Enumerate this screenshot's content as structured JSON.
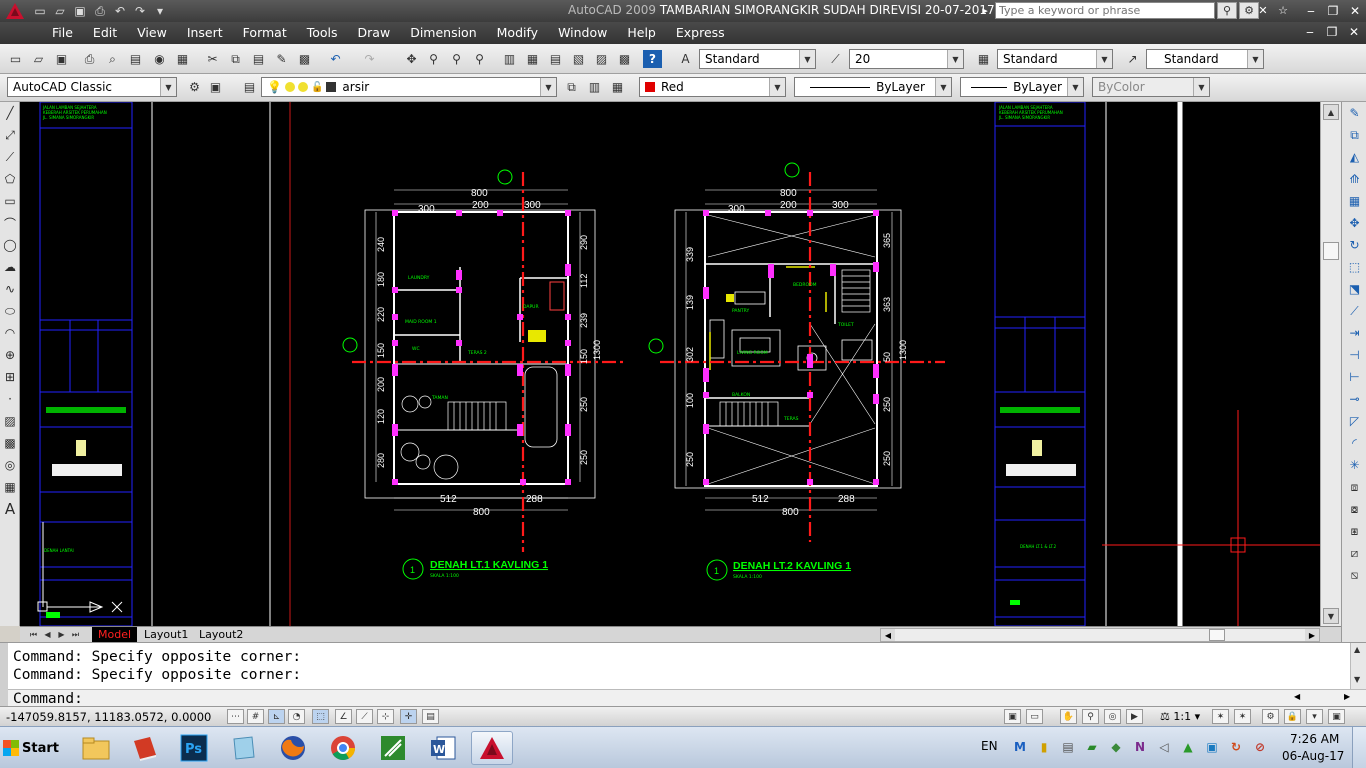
{
  "titlebar": {
    "app_version": "AutoCAD 2009",
    "file_name": "TAMBARIAN SIMORANGKIR SUDAH DIREVISI 20-07-2017.dwg",
    "search_placeholder": "Type a keyword or phrase"
  },
  "menubar": {
    "items": [
      "File",
      "Edit",
      "View",
      "Insert",
      "Format",
      "Tools",
      "Draw",
      "Dimension",
      "Modify",
      "Window",
      "Help",
      "Express"
    ]
  },
  "styles_toolbar": {
    "text_style": "Standard",
    "dim_scale": "20",
    "dim_style": "Standard",
    "multileader_style": "Standard"
  },
  "workspace_toolbar": {
    "workspace": "AutoCAD Classic",
    "layer": "arsir",
    "color": "Red",
    "color_hex": "#e00000",
    "linetype": "ByLayer",
    "lineweight": "ByLayer",
    "plot_style": "ByColor"
  },
  "layout_tabs": [
    "Model",
    "Layout1",
    "Layout2"
  ],
  "command_window": {
    "history": [
      "Command: Specify opposite corner:",
      "Command: Specify opposite corner:"
    ],
    "prompt": "Command:"
  },
  "status_bar": {
    "coordinates": "-147059.8157, 11183.0572, 0.0000",
    "annotation_scale": "1:1"
  },
  "drawing": {
    "plan_left_title": "DENAH LT.1  KAVLING 1",
    "plan_left_scale": "SKALA 1:100",
    "plan_right_title": "DENAH LT.2 KAVLING 1",
    "plan_right_scale": "SKALA 1:100",
    "title_number": "1",
    "dims_top": [
      "800",
      "300",
      "200",
      "300"
    ],
    "dims_bottom": [
      "512",
      "288",
      "800"
    ],
    "dims_bottom_left": [
      "512",
      "288",
      "800"
    ],
    "dims_left_l1": [
      "240",
      "180",
      "220",
      "150",
      "200",
      "120",
      "280"
    ],
    "dims_right_l1": [
      "290",
      "112",
      "239",
      "150",
      "250",
      "250",
      "1300"
    ],
    "dims_left_l2": [
      "339",
      "139",
      "302",
      "100",
      "250"
    ],
    "dims_right_l2": [
      "365",
      "363",
      "50",
      "250",
      "250",
      "1300"
    ],
    "room_labels_l1": [
      "LAUNDRY",
      "MAID ROOM 1",
      "TERAS 2",
      "TAMAN",
      "DAPUR",
      "WC"
    ],
    "room_labels_l2": [
      "BEDROOM",
      "PANTRY",
      "LIVING ROOM",
      "BALKON",
      "TERAS",
      "TOILET"
    ],
    "sheet_project": "KAVLINGA TEMBAS KEMBEDO",
    "layer_colors": {
      "background": "#000000",
      "walls": "#ffffff",
      "text": "#00ff00",
      "axis": "#ff1a1a",
      "columns": "#ff00ff",
      "border": "#2020ff"
    }
  },
  "taskbar": {
    "start_label": "Start",
    "language": "EN",
    "clock_time": "7:26 AM",
    "clock_date": "06-Aug-17"
  }
}
